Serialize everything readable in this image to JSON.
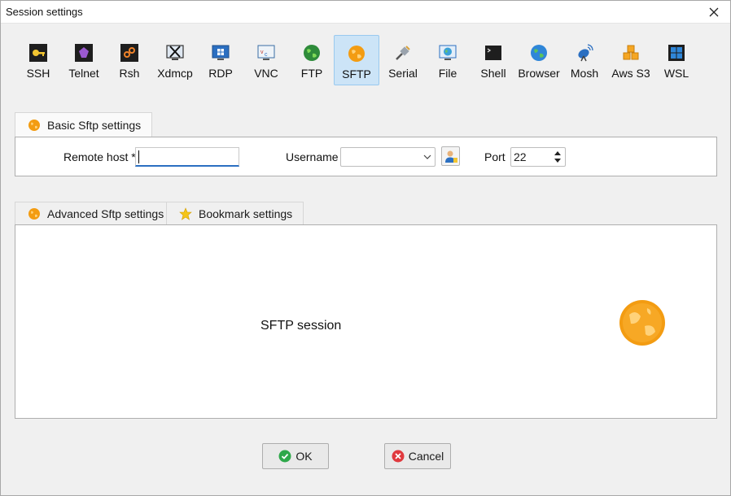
{
  "window": {
    "title": "Session settings"
  },
  "toolbar": {
    "items": [
      {
        "label": "SSH",
        "icon": "key-icon"
      },
      {
        "label": "Telnet",
        "icon": "telnet-icon"
      },
      {
        "label": "Rsh",
        "icon": "rsh-icon"
      },
      {
        "label": "Xdmcp",
        "icon": "xdmcp-icon"
      },
      {
        "label": "RDP",
        "icon": "rdp-icon"
      },
      {
        "label": "VNC",
        "icon": "vnc-icon"
      },
      {
        "label": "FTP",
        "icon": "ftp-globe-icon"
      },
      {
        "label": "SFTP",
        "icon": "sftp-globe-icon"
      },
      {
        "label": "Serial",
        "icon": "serial-plug-icon"
      },
      {
        "label": "File",
        "icon": "file-monitor-icon"
      },
      {
        "label": "Shell",
        "icon": "shell-terminal-icon"
      },
      {
        "label": "Browser",
        "icon": "browser-globe-icon"
      },
      {
        "label": "Mosh",
        "icon": "mosh-antenna-icon"
      },
      {
        "label": "Aws S3",
        "icon": "aws-cubes-icon"
      },
      {
        "label": "WSL",
        "icon": "windows-logo-icon"
      }
    ],
    "selected": "SFTP"
  },
  "basic": {
    "tab_label": "Basic Sftp settings",
    "remote_host_label": "Remote host *",
    "remote_host_value": "",
    "username_label": "Username",
    "username_value": "",
    "port_label": "Port",
    "port_value": "22"
  },
  "advanced": {
    "tabs": [
      {
        "label": "Advanced Sftp settings"
      },
      {
        "label": "Bookmark settings"
      }
    ],
    "session_text": "SFTP session"
  },
  "buttons": {
    "ok_label": "OK",
    "cancel_label": "Cancel"
  },
  "colors": {
    "accent_orange": "#f39c12",
    "selected_bg": "#cce4f7",
    "focus_blue": "#2b6fc1",
    "ok_green": "#2ea84a",
    "cancel_red": "#e0393e"
  }
}
